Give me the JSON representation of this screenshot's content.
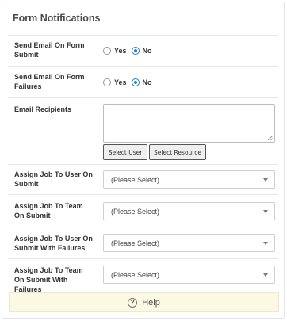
{
  "panel": {
    "title": "Form Notifications"
  },
  "fields": {
    "send_email_submit": {
      "label": "Send Email On Form Submit",
      "yes": "Yes",
      "no": "No",
      "selected": "No"
    },
    "send_email_failures": {
      "label": "Send Email On Form Failures",
      "yes": "Yes",
      "no": "No",
      "selected": "No"
    },
    "email_recipients": {
      "label": "Email Recipients",
      "value": "",
      "select_user": "Select User",
      "select_resource": "Select Resource"
    },
    "assign_user_submit": {
      "label": "Assign Job To User On Submit",
      "value": "(Please Select)"
    },
    "assign_team_submit": {
      "label": "Assign Job To Team On Submit",
      "value": "(Please Select)"
    },
    "assign_user_failures": {
      "label": "Assign Job To User On Submit With Failures",
      "value": "(Please Select)"
    },
    "assign_team_failures": {
      "label": "Assign Job To Team On Submit With Failures",
      "value": "(Please Select)"
    }
  },
  "help": {
    "label": "Help",
    "icon": "question-circle-icon"
  },
  "colors": {
    "radio_accent": "#1e7fd6",
    "help_background": "#fbf8e4"
  }
}
